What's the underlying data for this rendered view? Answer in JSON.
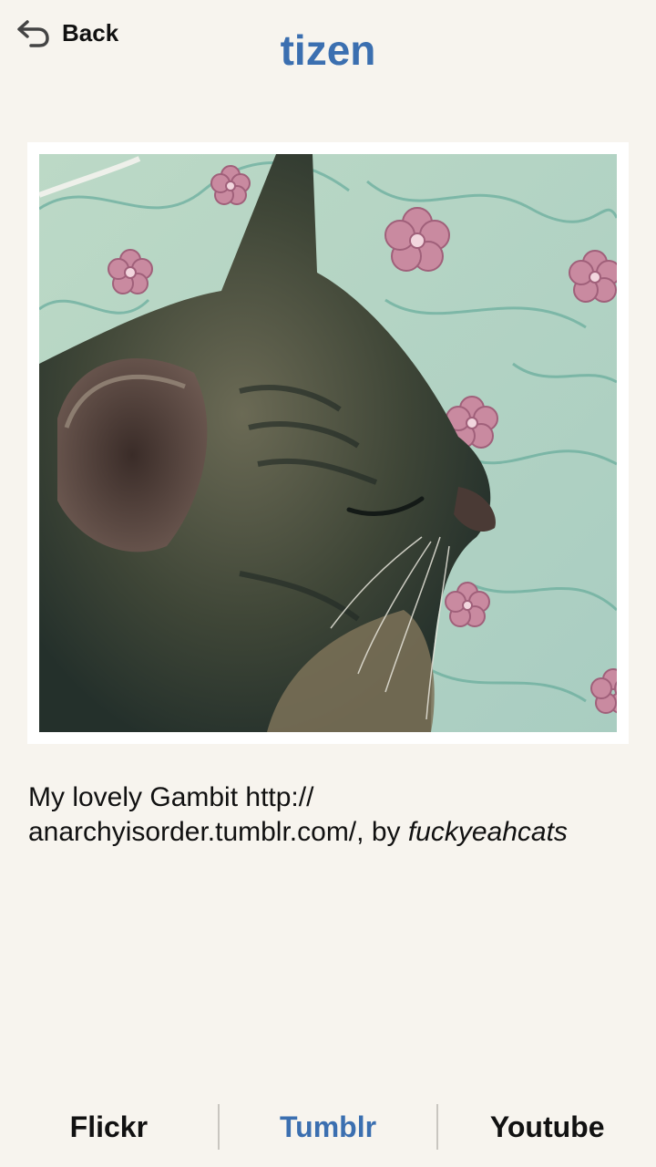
{
  "header": {
    "back_label": "Back",
    "title": "tizen"
  },
  "post": {
    "caption_text": "My lovely Gambit http:// anarchyisorder.tumblr.com/, by ",
    "author": "fuckyeahcats"
  },
  "tabs": [
    {
      "label": "Flickr",
      "active": false
    },
    {
      "label": "Tumblr",
      "active": true
    },
    {
      "label": "Youtube",
      "active": false
    }
  ],
  "colors": {
    "accent": "#3b6fb0",
    "background": "#f7f4ee"
  }
}
